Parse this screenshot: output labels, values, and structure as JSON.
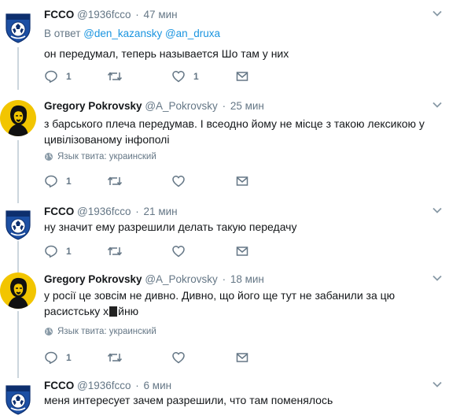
{
  "colors": {
    "link": "#1b95e0",
    "muted": "#657786",
    "text": "#14171a",
    "line": "#ccd6dd"
  },
  "icons": {
    "reply": "reply-icon",
    "retweet": "retweet-icon",
    "like": "heart-icon",
    "dm": "envelope-icon",
    "globe": "globe-icon",
    "more": "chevron-down-icon"
  },
  "tweets": [
    {
      "name": "FCCO",
      "handle": "@1936fcco",
      "time": "47 мин",
      "reply_prefix": "В ответ",
      "reply_mentions": [
        "@den_kazansky",
        "@an_druxa"
      ],
      "text": "он передумал, теперь называется Шо там у них",
      "reply_count": "1",
      "retweet_count": "",
      "like_count": "1"
    },
    {
      "name": "Gregory Pokrovsky",
      "handle": "@A_Pokrovsky",
      "time": "25 мин",
      "text": "з барського плеча передумав. І всеодно йому не місце з такою лексикою у цивілізованому інфополі",
      "lang_label": "Язык твита: украинский",
      "reply_count": "1",
      "retweet_count": "",
      "like_count": ""
    },
    {
      "name": "FCCO",
      "handle": "@1936fcco",
      "time": "21 мин",
      "text": "ну значит ему разрешили делать такую передачу",
      "reply_count": "1",
      "retweet_count": "",
      "like_count": ""
    },
    {
      "name": "Gregory Pokrovsky",
      "handle": "@A_Pokrovsky",
      "time": "18 мин",
      "text_line1": "у росії це зовсім не дивно. Дивно, що його ще тут не забанили за цю",
      "text_line2_a": "расистську х",
      "text_line2_b": "йню",
      "lang_label": "Язык твита: украинский",
      "reply_count": "1",
      "retweet_count": "",
      "like_count": ""
    },
    {
      "name": "FCCO",
      "handle": "@1936fcco",
      "time": "6 мин",
      "text": "меня интересует зачем разрешили, что там поменялось"
    }
  ]
}
